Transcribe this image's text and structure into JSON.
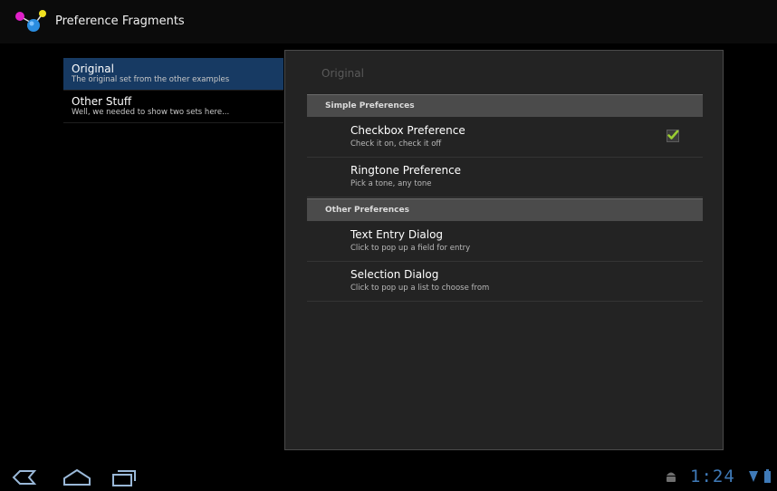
{
  "app": {
    "title": "Preference Fragments"
  },
  "headers": [
    {
      "title": "Original",
      "summary": "The original set from the other examples",
      "selected": true
    },
    {
      "title": "Other Stuff",
      "summary": "Well, we needed to show two sets here...",
      "selected": false
    }
  ],
  "pane": {
    "title": "Original",
    "categories": [
      {
        "label": "Simple Preferences",
        "items": [
          {
            "title": "Checkbox Preference",
            "summary": "Check it on, check it off",
            "checked": true
          },
          {
            "title": "Ringtone Preference",
            "summary": "Pick a tone, any tone"
          }
        ]
      },
      {
        "label": "Other Preferences",
        "items": [
          {
            "title": "Text Entry Dialog",
            "summary": "Click to pop up a field for entry"
          },
          {
            "title": "Selection Dialog",
            "summary": "Click to pop up a list to choose from"
          }
        ]
      }
    ]
  },
  "system_bar": {
    "time": "1:24",
    "icons": [
      "back-icon",
      "home-icon",
      "recent-apps-icon",
      "android-notification-icon",
      "wifi-icon",
      "battery-icon"
    ],
    "clock_color": "#3f7ab8"
  },
  "colors": {
    "selected_header": "#173a63",
    "category_bar": "#4b4b4b",
    "checkbox_check": "#9acd32"
  }
}
